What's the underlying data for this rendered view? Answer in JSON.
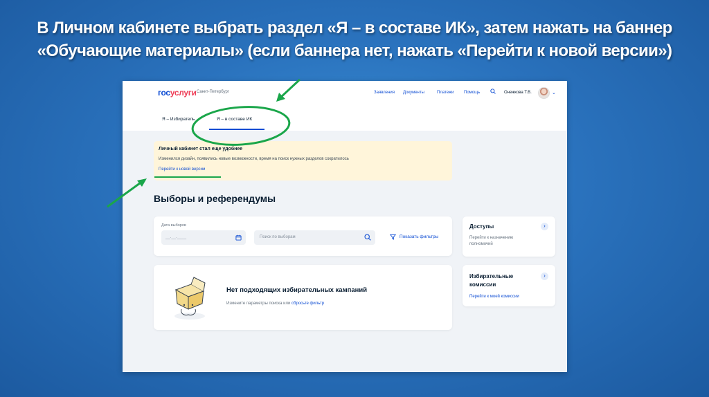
{
  "slide": {
    "title_line1": "В Личном кабинете выбрать раздел «Я – в составе ИК», затем нажать на баннер",
    "title_line2": "«Обучающие материалы» (если баннера нет, нажать «Перейти к новой версии»)"
  },
  "header": {
    "logo_part1": "гос",
    "logo_part2": "услуги",
    "region": "Санкт-Петербург",
    "nav": [
      "Заявления",
      "Документы",
      "Платежи",
      "Помощь"
    ],
    "user": "Онежкова Т.В."
  },
  "tabs": [
    {
      "label": "Я – Избиратель"
    },
    {
      "label": "Я – в составе ИК"
    }
  ],
  "banner": {
    "title": "Личный кабинет стал еще удобнее",
    "text": "Изменился дизайн, появились новые возможности, время на поиск нужных разделов сократилось",
    "link": "Перейти к новой версии"
  },
  "section_title": "Выборы и референдумы",
  "filters": {
    "date_label": "Дата выборов",
    "date_placeholder": "__.__.____",
    "search_placeholder": "Поиск по выборам",
    "show_filters": "Показать фильтры"
  },
  "empty_state": {
    "heading": "Нет подходящих избирательных кампаний",
    "text": "Измените параметры поиска или",
    "reset_link": "сбросьте фильтр"
  },
  "side_cards": {
    "access_title": "Доступы",
    "access_text_line1": "Перейти к назначению",
    "access_text_line2": "полномочий",
    "commissions_title_line1": "Избирательные",
    "commissions_title_line2": "комиссии",
    "commissions_link": "Перейти к моей комиссии"
  },
  "colors": {
    "brand_blue": "#0d4cd3",
    "brand_red": "#ee3f58",
    "banner_bg": "#fff5da",
    "annotation_green": "#1aa64a"
  }
}
